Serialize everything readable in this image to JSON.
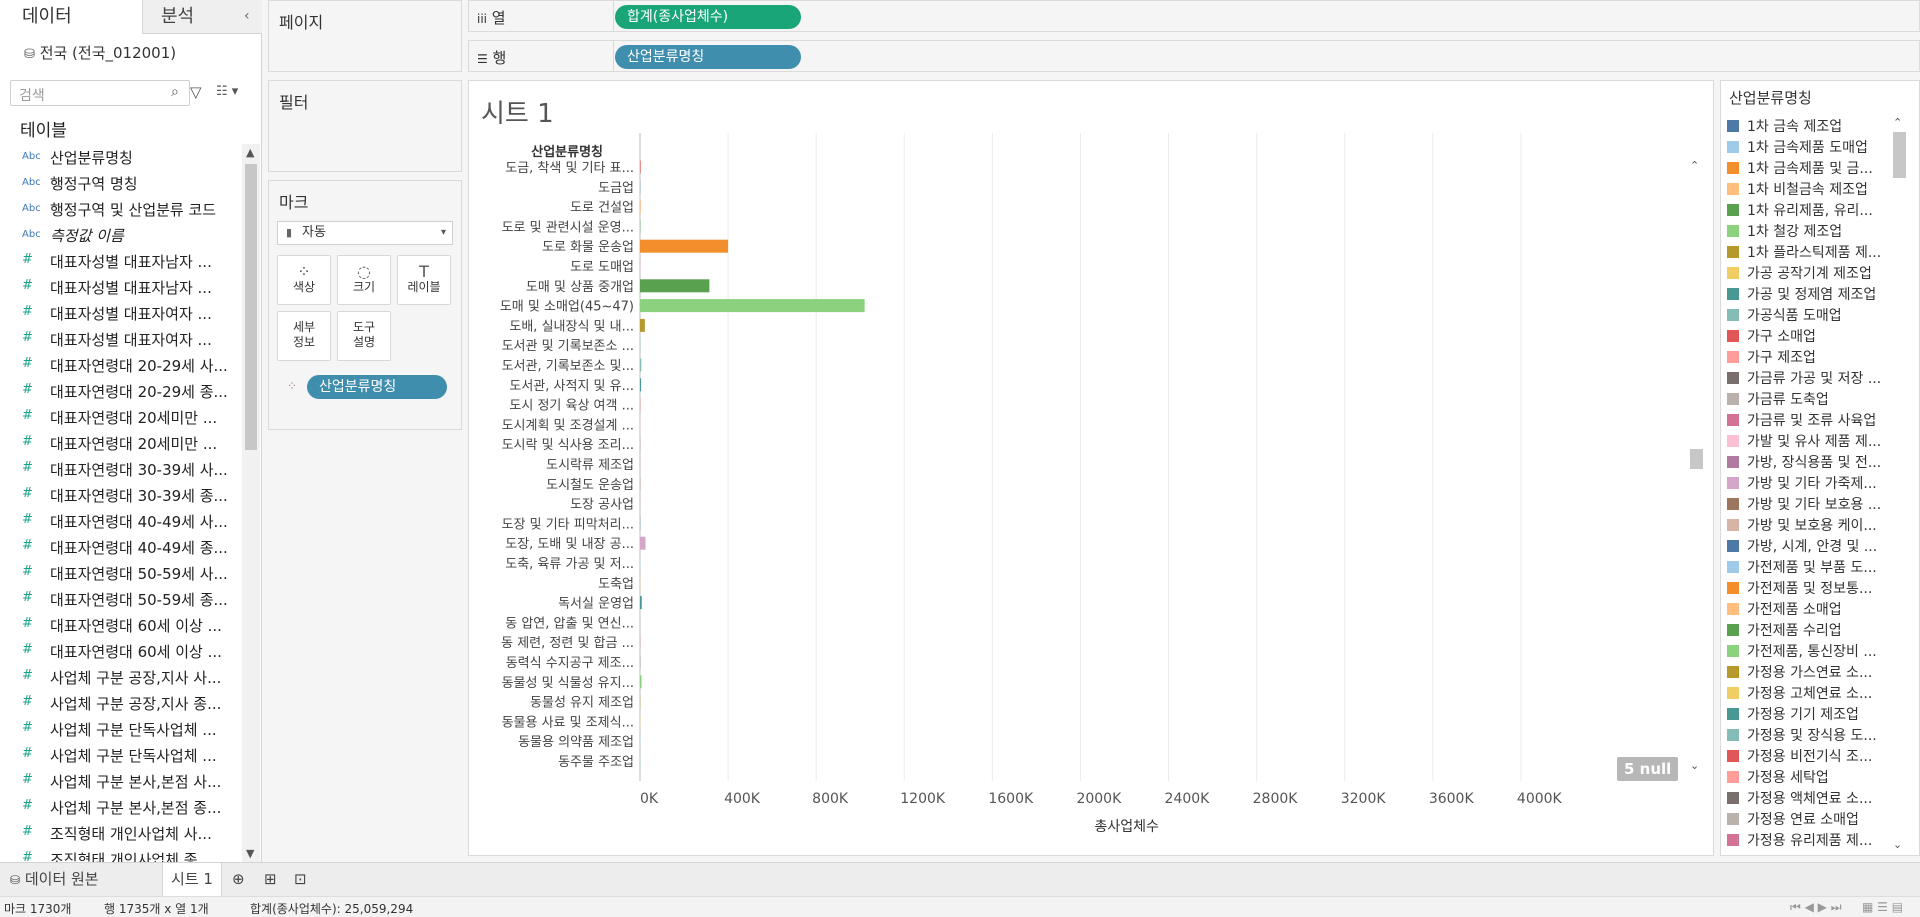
{
  "left_pane": {
    "tab_data": "데이터",
    "tab_analysis": "분석",
    "datasource": "전국 (전국_012001)",
    "search_placeholder": "검색",
    "tables_header": "테이블",
    "fields": [
      {
        "type": "Abc",
        "name": "산업분류명칭",
        "italic": false
      },
      {
        "type": "Abc",
        "name": "행정구역 명칭",
        "italic": false
      },
      {
        "type": "Abc",
        "name": "행정구역 및 산업분류 코드",
        "italic": false
      },
      {
        "type": "Abc",
        "name": "측정값 이름",
        "italic": true
      },
      {
        "type": "#",
        "name": "대표자성별 대표자남자 ...",
        "italic": false
      },
      {
        "type": "#",
        "name": "대표자성별 대표자남자 ...",
        "italic": false
      },
      {
        "type": "#",
        "name": "대표자성별 대표자여자 ...",
        "italic": false
      },
      {
        "type": "#",
        "name": "대표자성별 대표자여자 ...",
        "italic": false
      },
      {
        "type": "#",
        "name": "대표자연령대 20-29세 사...",
        "italic": false
      },
      {
        "type": "#",
        "name": "대표자연령대 20-29세 종...",
        "italic": false
      },
      {
        "type": "#",
        "name": "대표자연령대 20세미만 ...",
        "italic": false
      },
      {
        "type": "#",
        "name": "대표자연령대 20세미만 ...",
        "italic": false
      },
      {
        "type": "#",
        "name": "대표자연령대 30-39세 사...",
        "italic": false
      },
      {
        "type": "#",
        "name": "대표자연령대 30-39세 종...",
        "italic": false
      },
      {
        "type": "#",
        "name": "대표자연령대 40-49세 사...",
        "italic": false
      },
      {
        "type": "#",
        "name": "대표자연령대 40-49세 종...",
        "italic": false
      },
      {
        "type": "#",
        "name": "대표자연령대 50-59세 사...",
        "italic": false
      },
      {
        "type": "#",
        "name": "대표자연령대 50-59세 종...",
        "italic": false
      },
      {
        "type": "#",
        "name": "대표자연령대 60세 이상 ...",
        "italic": false
      },
      {
        "type": "#",
        "name": "대표자연령대 60세 이상 ...",
        "italic": false
      },
      {
        "type": "#",
        "name": "사업체 구분 공장,지사 사...",
        "italic": false
      },
      {
        "type": "#",
        "name": "사업체 구분 공장,지사 종...",
        "italic": false
      },
      {
        "type": "#",
        "name": "사업체 구분 단독사업체 ...",
        "italic": false
      },
      {
        "type": "#",
        "name": "사업체 구분 단독사업체 ...",
        "italic": false
      },
      {
        "type": "#",
        "name": "사업체 구분 본사,본점 사...",
        "italic": false
      },
      {
        "type": "#",
        "name": "사업체 구분 본사,본점 종...",
        "italic": false
      },
      {
        "type": "#",
        "name": "조직형태 개인사업체 사...",
        "italic": false
      },
      {
        "type": "#",
        "name": "조직형태 개인사업체 종...",
        "italic": false
      }
    ]
  },
  "cards": {
    "pages": "페이지",
    "filters": "필터",
    "marks": "마크",
    "marks_type": "자동",
    "marks_buttons": [
      {
        "icon": "color-icon",
        "label1": "색상",
        "label2": ""
      },
      {
        "icon": "size-icon",
        "label1": "크기",
        "label2": ""
      },
      {
        "icon": "label-icon",
        "label1": "레이블",
        "label2": ""
      },
      {
        "icon": "",
        "label1": "세부",
        "label2": "정보"
      },
      {
        "icon": "",
        "label1": "도구",
        "label2": "설명"
      }
    ],
    "marks_pill": "산업분류명칭"
  },
  "shelves": {
    "columns_label": "열",
    "columns_pill": "합계(종사업체수)",
    "rows_label": "행",
    "rows_pill": "산업분류명칭"
  },
  "sheet": {
    "title": "시트 1",
    "row_header": "산업분류명칭",
    "null_badge": "5 null"
  },
  "chart_data": {
    "type": "bar",
    "orientation": "horizontal",
    "categories": [
      "도금, 착색 및 기타 표...",
      "도금업",
      "도로 건설업",
      "도로 및 관련시설 운영...",
      "도로 화물 운송업",
      "도로 도매업",
      "도매 및 상품 중개업",
      "도매 및 소매업(45~47)",
      "도배, 실내장식 및 내...",
      "도서관 및 기록보존소 ...",
      "도서관, 기록보존소 및...",
      "도서관, 사적지 및 유...",
      "도시 정기 육상 여객 ...",
      "도시계획 및 조경설계 ...",
      "도시락 및 식사용 조리...",
      "도시락류 제조업",
      "도시철도 운송업",
      "도장 공사업",
      "도장 및 기타 피막처리...",
      "도장, 도배 및 내장 공...",
      "도축, 육류 가공 및 저...",
      "도축업",
      "독서실 운영업",
      "동 압연, 압출 및 연신...",
      "동 제련, 정련 및 합금 ...",
      "동력식 수지공구 제조...",
      "동물성 및 식물성 유지...",
      "동물성 유지 제조업",
      "동물용 사료 및 조제식...",
      "동물용 의약품 제조업",
      "동주물 주조업"
    ],
    "values": [
      3000,
      1000,
      2000,
      1500,
      400000,
      1000,
      315000,
      1020000,
      22000,
      1000,
      6000,
      5000,
      1000,
      1000,
      1000,
      1000,
      1000,
      1000,
      1000,
      25000,
      1000,
      1000,
      8000,
      1000,
      1000,
      1000,
      7000,
      1000,
      1000,
      1000,
      1000
    ],
    "colors": [
      "#e15759",
      "#4e79a7",
      "#f28e2b",
      "#59a14f",
      "#f28e2b",
      "#ff9da7",
      "#59a14f",
      "#8cd17d",
      "#b6992d",
      "#76b7b2",
      "#86bcb6",
      "#499894",
      "#e15759",
      "#fabfd2",
      "#b07aa1",
      "#d4a6c8",
      "#9d7660",
      "#d7b5a6",
      "#4e79a7",
      "#d4a6c8",
      "#a0cbe8",
      "#ffbe7d",
      "#499894",
      "#bab0ac",
      "#d37295",
      "#79706e",
      "#8cd17d",
      "#b6992d",
      "#f1ce63",
      "#a0cbe8",
      "#86bcb6"
    ],
    "xlabel": "총사업체수",
    "xticks": [
      "0K",
      "400K",
      "800K",
      "1200K",
      "1600K",
      "2000K",
      "2400K",
      "2800K",
      "3200K",
      "3600K",
      "4000K"
    ],
    "xlim": [
      0,
      4400000
    ],
    "grid": true,
    "legend": "right"
  },
  "legend": {
    "title": "산업분류명칭",
    "items": [
      {
        "label": "1차 금속 제조업",
        "color": "#4e79a7"
      },
      {
        "label": "1차 금속제품 도매업",
        "color": "#a0cbe8"
      },
      {
        "label": "1차 금속제품 및 금...",
        "color": "#f28e2b"
      },
      {
        "label": "1차 비철금속 제조업",
        "color": "#ffbe7d"
      },
      {
        "label": "1차 유리제품, 유리...",
        "color": "#59a14f"
      },
      {
        "label": "1차 철강 제조업",
        "color": "#8cd17d"
      },
      {
        "label": "1차 플라스틱제품 제...",
        "color": "#b6992d"
      },
      {
        "label": "가공 공작기계 제조업",
        "color": "#f1ce63"
      },
      {
        "label": "가공 및 정제염 제조업",
        "color": "#499894"
      },
      {
        "label": "가공식품 도매업",
        "color": "#86bcb6"
      },
      {
        "label": "가구 소매업",
        "color": "#e15759"
      },
      {
        "label": "가구 제조업",
        "color": "#ff9d9a"
      },
      {
        "label": "가금류 가공 및 저장 ...",
        "color": "#79706e"
      },
      {
        "label": "가금류 도축업",
        "color": "#bab0ac"
      },
      {
        "label": "가금류 및 조류 사육업",
        "color": "#d37295"
      },
      {
        "label": "가발 및 유사 제품 제...",
        "color": "#fabfd2"
      },
      {
        "label": "가방, 장식용품 및 전...",
        "color": "#b07aa1"
      },
      {
        "label": "가방 및 기타 가죽제...",
        "color": "#d4a6c8"
      },
      {
        "label": "가방 및 기타 보호용 ...",
        "color": "#9d7660"
      },
      {
        "label": "가방 및 보호용 케이...",
        "color": "#d7b5a6"
      },
      {
        "label": "가방, 시계, 안경 및 ...",
        "color": "#4e79a7"
      },
      {
        "label": "가전제품 및 부품 도...",
        "color": "#a0cbe8"
      },
      {
        "label": "가전제품 및 정보통...",
        "color": "#f28e2b"
      },
      {
        "label": "가전제품 소매업",
        "color": "#ffbe7d"
      },
      {
        "label": "가전제품 수리업",
        "color": "#59a14f"
      },
      {
        "label": "가전제품, 통신장비 ...",
        "color": "#8cd17d"
      },
      {
        "label": "가정용 가스연료 소...",
        "color": "#b6992d"
      },
      {
        "label": "가정용 고체연료 소...",
        "color": "#f1ce63"
      },
      {
        "label": "가정용 기기 제조업",
        "color": "#499894"
      },
      {
        "label": "가정용 및 장식용 도...",
        "color": "#86bcb6"
      },
      {
        "label": "가정용 비전기식 조...",
        "color": "#e15759"
      },
      {
        "label": "가정용 세탁업",
        "color": "#ff9d9a"
      },
      {
        "label": "가정용 액체연료 소...",
        "color": "#79706e"
      },
      {
        "label": "가정용 연료 소매업",
        "color": "#bab0ac"
      },
      {
        "label": "가정용 유리제품 제...",
        "color": "#d37295"
      }
    ]
  },
  "bottom": {
    "datasource_tab": "데이터 원본",
    "sheet_tab": "시트 1",
    "status_marks": "마크 1730개",
    "status_rows": "행 1735개 x 열 1개",
    "status_sum": "합계(종사업체수): 25,059,294"
  }
}
